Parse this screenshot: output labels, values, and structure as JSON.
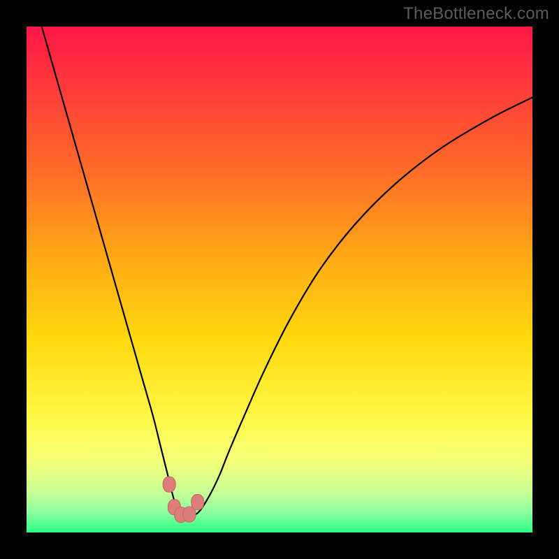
{
  "watermark": "TheBottleneck.com",
  "colors": {
    "frame": "#000000",
    "curve": "#000000",
    "marker_fill": "#db7e7b",
    "marker_stroke": "#c86360",
    "gradient_stops": [
      {
        "offset": 0.0,
        "color": "#ff1648"
      },
      {
        "offset": 0.12,
        "color": "#ff3a3a"
      },
      {
        "offset": 0.28,
        "color": "#ff6a28"
      },
      {
        "offset": 0.45,
        "color": "#ffa716"
      },
      {
        "offset": 0.62,
        "color": "#ffd90d"
      },
      {
        "offset": 0.78,
        "color": "#fff94a"
      },
      {
        "offset": 0.86,
        "color": "#f4ff78"
      },
      {
        "offset": 0.92,
        "color": "#c8ff96"
      },
      {
        "offset": 0.96,
        "color": "#8cffa0"
      },
      {
        "offset": 1.0,
        "color": "#2bfd84"
      }
    ]
  },
  "chart_data": {
    "type": "line",
    "title": "",
    "xlabel": "",
    "ylabel": "",
    "xlim": [
      0,
      100
    ],
    "ylim": [
      0,
      100
    ],
    "note": "x and y are in percent of the plot area; y=100 is top, y=0 is bottom. Values estimated from pixels.",
    "series": [
      {
        "name": "bottleneck-curve",
        "x": [
          3,
          5,
          7,
          9,
          11,
          13,
          15,
          17,
          19,
          21,
          23,
          25,
          26.5,
          28,
          29,
          30,
          31,
          32.5,
          34,
          36,
          38,
          40,
          43,
          47,
          52,
          58,
          65,
          73,
          82,
          92,
          100
        ],
        "y": [
          100,
          93,
          86,
          79,
          72,
          65,
          58,
          51,
          44,
          37,
          30,
          23,
          17,
          11,
          7,
          4.2,
          3.3,
          3.3,
          4,
          7,
          11,
          16,
          23,
          32,
          42,
          52,
          61,
          69,
          76,
          82,
          86
        ]
      }
    ],
    "markers": [
      {
        "x": 28.2,
        "y": 9.5
      },
      {
        "x": 29.2,
        "y": 5.0
      },
      {
        "x": 30.5,
        "y": 3.5
      },
      {
        "x": 32.2,
        "y": 3.6
      },
      {
        "x": 33.8,
        "y": 6.0
      }
    ]
  }
}
